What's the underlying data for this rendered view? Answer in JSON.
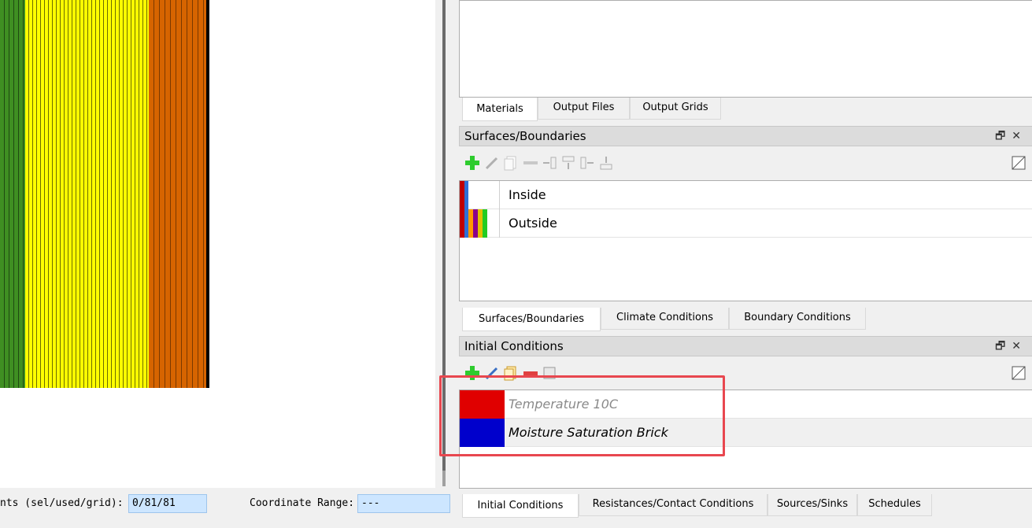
{
  "canvas": {
    "strip_colors": {
      "green": "#3f8f22",
      "yellow": "#ffff00",
      "orange": "#d66400"
    }
  },
  "top_tabs": [
    "Materials",
    "Output Files",
    "Output Grids"
  ],
  "surfaces": {
    "title": "Surfaces/Boundaries",
    "rows": [
      {
        "label": "Inside"
      },
      {
        "label": "Outside"
      }
    ]
  },
  "middle_tabs": [
    "Surfaces/Boundaries",
    "Climate Conditions",
    "Boundary Conditions"
  ],
  "initial_conditions": {
    "title": "Initial Conditions",
    "rows": [
      {
        "label": "Temperature 10C",
        "color": "#e00000"
      },
      {
        "label": "Moisture Saturation Brick",
        "color": "#0000cc"
      }
    ]
  },
  "bottom_tabs": [
    "Initial Conditions",
    "Resistances/Contact Conditions",
    "Sources/Sinks",
    "Schedules"
  ],
  "status": {
    "elements_label": "nts (sel/used/grid):",
    "elements_value": "0/81/81",
    "coord_label": "Coordinate Range:",
    "coord_value": "---"
  },
  "icons": [
    "add-icon",
    "edit-icon",
    "copy-icon",
    "remove-icon",
    "split-icon",
    "merge-icon",
    "float-icon",
    "close-icon",
    "toggle-view-icon"
  ]
}
